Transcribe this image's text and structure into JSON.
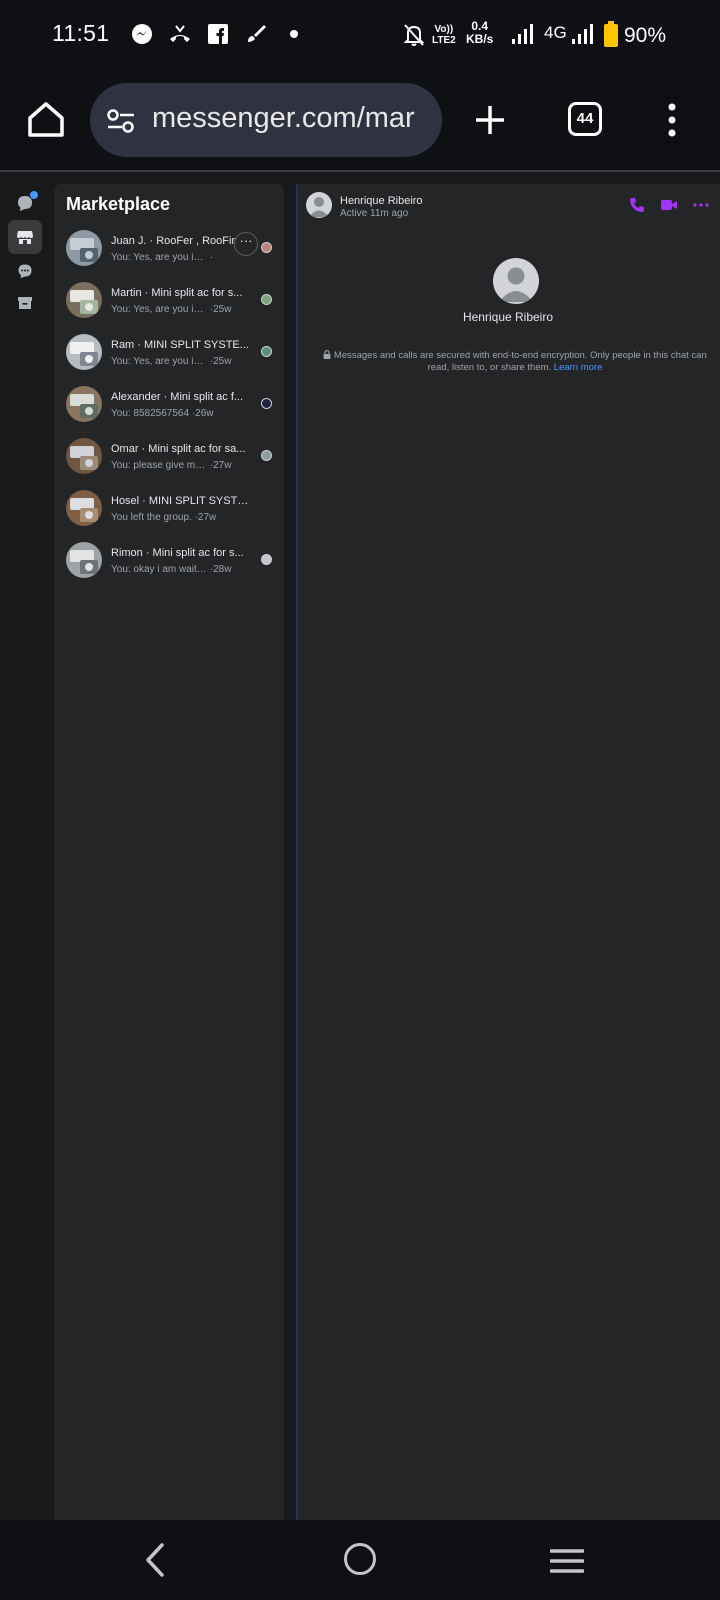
{
  "status_bar": {
    "time": "11:51",
    "icons_left": [
      "messenger-icon",
      "missed-call-icon",
      "facebook-icon",
      "brush-icon",
      "dot-icon"
    ],
    "volte": "Vo))",
    "lte": "LTE2",
    "speed_value": "0.4",
    "speed_unit": "KB/s",
    "network": "4G",
    "battery": "90%"
  },
  "browser": {
    "url": "messenger.com/mar",
    "tab_count": "44"
  },
  "inbox": {
    "title": "Marketplace",
    "threads": [
      {
        "title": "Juan J. · RooFer , RooFing",
        "snippet": "You: Yes, are you interested",
        "time": "·",
        "hover": true
      },
      {
        "title": "Martin · Mini split ac for s...",
        "snippet": "You: Yes, are you interested",
        "time": "·25w"
      },
      {
        "title": "Ram · MINI SPLIT SYSTE...",
        "snippet": "You: Yes, are you interested",
        "time": "·25w"
      },
      {
        "title": "Alexander · Mini split ac f...",
        "snippet": "You: 8582567564",
        "time": "·26w"
      },
      {
        "title": "Omar · Mini split ac for sa...",
        "snippet": "You: please give me a call",
        "time": "·27w"
      },
      {
        "title": "Hosel · MINI SPLIT SYSTE...",
        "snippet": "You left the group.",
        "time": "·27w"
      },
      {
        "title": "Rimon · Mini split ac for s...",
        "snippet": "You: okay i am waiting please",
        "time": "·28w"
      }
    ],
    "more_label": "···"
  },
  "chat": {
    "name": "Henrique Ribeiro",
    "status": "Active 11m ago",
    "profile_name": "Henrique Ribeiro",
    "e2ee_text": "Messages and calls are secured with end-to-end encryption. Only people in this chat can read, listen to, or share them.",
    "learn_more": "Learn more",
    "accent": "#a033ff"
  }
}
